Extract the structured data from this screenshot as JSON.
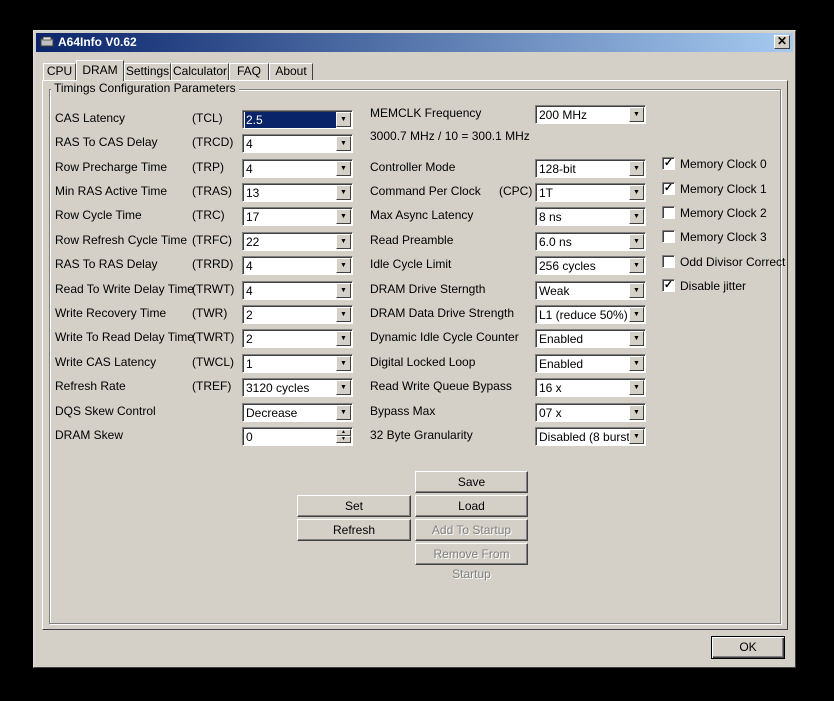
{
  "window": {
    "title": "A64Info V0.62",
    "close_glyph": "✕"
  },
  "tabs": [
    {
      "label": "CPU"
    },
    {
      "label": "DRAM"
    },
    {
      "label": "Settings"
    },
    {
      "label": "Calculator"
    },
    {
      "label": "FAQ"
    },
    {
      "label": "About"
    }
  ],
  "active_tab": "DRAM",
  "group_label": "Timings Configuration Parameters",
  "left_params": [
    {
      "label": "CAS Latency",
      "abbr": "(TCL)",
      "value": "2.5"
    },
    {
      "label": "RAS To CAS Delay",
      "abbr": "(TRCD)",
      "value": "4"
    },
    {
      "label": "Row Precharge Time",
      "abbr": "(TRP)",
      "value": "4"
    },
    {
      "label": "Min RAS Active Time",
      "abbr": "(TRAS)",
      "value": "13"
    },
    {
      "label": "Row Cycle Time",
      "abbr": "(TRC)",
      "value": "17"
    },
    {
      "label": "Row Refresh Cycle Time",
      "abbr": "(TRFC)",
      "value": "22"
    },
    {
      "label": "RAS To RAS Delay",
      "abbr": "(TRRD)",
      "value": "4"
    },
    {
      "label": "Read To Write Delay Time",
      "abbr": "(TRWT)",
      "value": "4"
    },
    {
      "label": "Write Recovery Time",
      "abbr": "(TWR)",
      "value": "2"
    },
    {
      "label": "Write To Read Delay Time",
      "abbr": "(TWRT)",
      "value": "2"
    },
    {
      "label": "Write CAS Latency",
      "abbr": "(TWCL)",
      "value": "1"
    },
    {
      "label": "Refresh Rate",
      "abbr": "(TREF)",
      "value": "3120 cycles"
    },
    {
      "label": "DQS Skew Control",
      "abbr": "",
      "value": "Decrease"
    },
    {
      "label": "DRAM Skew",
      "abbr": "",
      "value": "0"
    }
  ],
  "memclk": {
    "label": "MEMCLK Frequency",
    "value": "200 MHz",
    "calc": "3000.7 MHz / 10 = 300.1 MHz"
  },
  "right_params": [
    {
      "label": "Controller Mode",
      "abbr": "",
      "value": "128-bit"
    },
    {
      "label": "Command Per Clock",
      "abbr": "(CPC)",
      "value": "1T"
    },
    {
      "label": "Max Async Latency",
      "abbr": "",
      "value": "8 ns"
    },
    {
      "label": "Read Preamble",
      "abbr": "",
      "value": "6.0 ns"
    },
    {
      "label": "Idle Cycle Limit",
      "abbr": "",
      "value": "256 cycles"
    },
    {
      "label": "DRAM Drive Sterngth",
      "abbr": "",
      "value": "Weak"
    },
    {
      "label": "DRAM Data Drive Strength",
      "abbr": "",
      "value": "L1 (reduce 50%)"
    },
    {
      "label": "Dynamic Idle Cycle Counter",
      "abbr": "",
      "value": "Enabled"
    },
    {
      "label": "Digital Locked Loop",
      "abbr": "",
      "value": "Enabled"
    },
    {
      "label": "Read Write Queue Bypass",
      "abbr": "",
      "value": "16 x"
    },
    {
      "label": "Bypass Max",
      "abbr": "",
      "value": "07 x"
    },
    {
      "label": "32 Byte Granularity",
      "abbr": "",
      "value": "Disabled (8 bursts)"
    }
  ],
  "checkboxes": [
    {
      "label": "Memory Clock 0",
      "checked": true
    },
    {
      "label": "Memory Clock 1",
      "checked": true
    },
    {
      "label": "Memory Clock 2",
      "checked": false
    },
    {
      "label": "Memory Clock 3",
      "checked": false
    },
    {
      "label": "Odd Divisor Correct",
      "checked": false
    },
    {
      "label": "Disable jitter",
      "checked": true
    }
  ],
  "check_glyph": "✓",
  "buttons": {
    "save": "Save",
    "set": "Set",
    "load": "Load",
    "refresh": "Refresh",
    "add_to_startup": "Add To Startup",
    "remove_from_startup": "Remove From Startup",
    "ok": "OK"
  },
  "arrow_glyph": "▼",
  "spin_up": "▲",
  "spin_down": "▼"
}
